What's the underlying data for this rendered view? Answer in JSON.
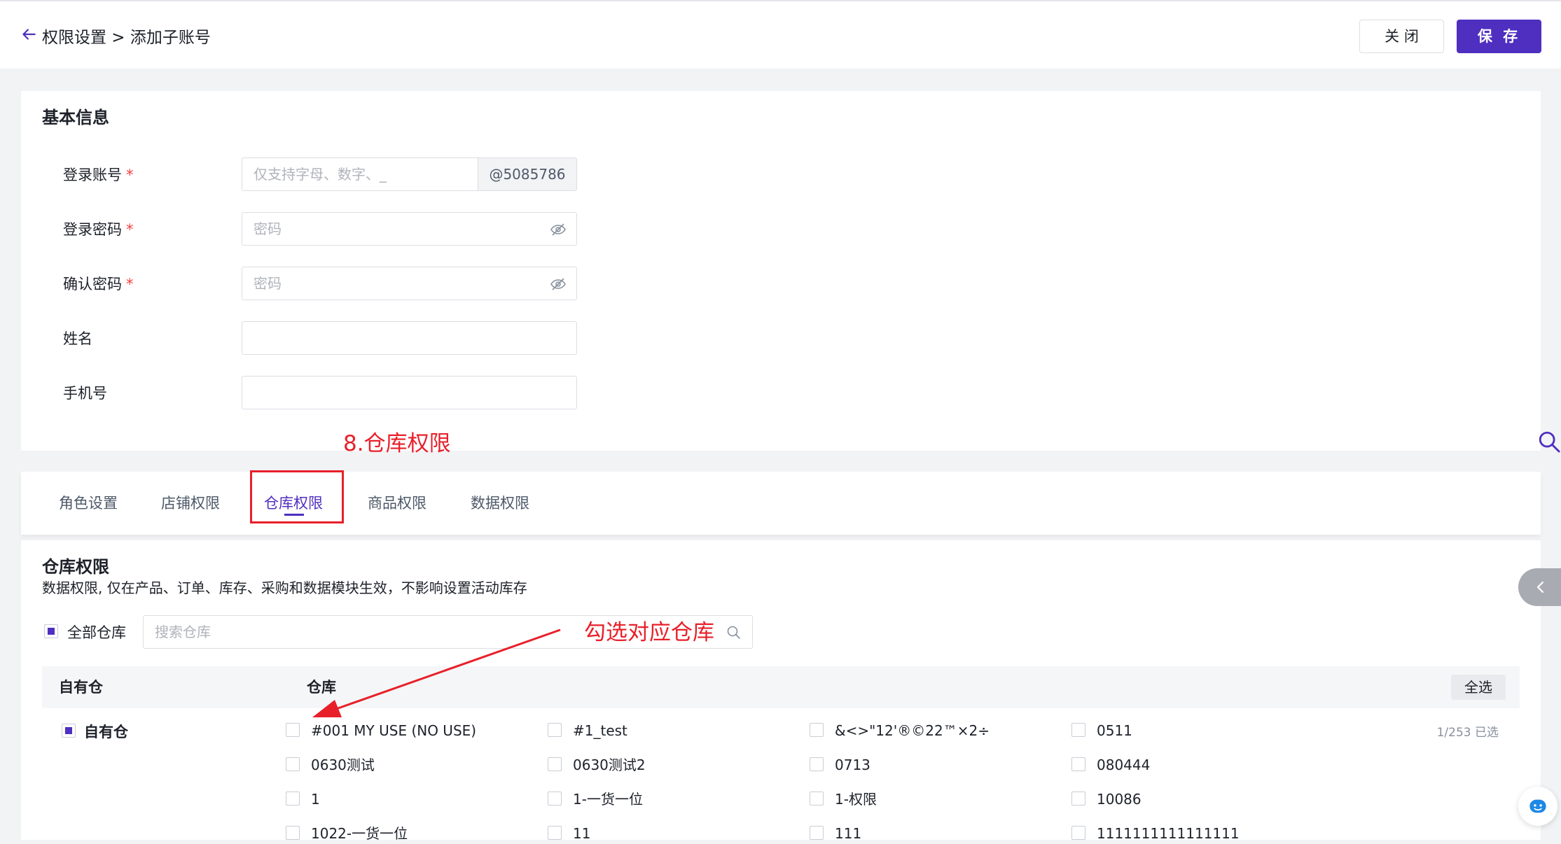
{
  "header": {
    "breadcrumb": "权限设置 > 添加子账号",
    "close_label": "关 闭",
    "save_label": "保 存"
  },
  "basic_info": {
    "title": "基本信息",
    "fields": {
      "account": {
        "label": "登录账号",
        "required": "*",
        "placeholder": "仅支持字母、数字、_",
        "suffix": "@5085786"
      },
      "password": {
        "label": "登录密码",
        "required": "*",
        "placeholder": "密码"
      },
      "confirm": {
        "label": "确认密码",
        "required": "*",
        "placeholder": "密码"
      },
      "name": {
        "label": "姓名",
        "value": ""
      },
      "phone": {
        "label": "手机号",
        "value": ""
      }
    }
  },
  "annotations": {
    "step_label": "8.仓库权限",
    "hint": "勾选对应仓库",
    "color": "#e8202a"
  },
  "tabs": [
    {
      "label": "角色设置"
    },
    {
      "label": "店铺权限"
    },
    {
      "label": "仓库权限",
      "active": true
    },
    {
      "label": "商品权限"
    },
    {
      "label": "数据权限"
    }
  ],
  "warehouse": {
    "title": "仓库权限",
    "description": "数据权限, 仅在产品、订单、库存、采购和数据模块生效，不影响设置活动库存",
    "all_label": "全部仓库",
    "search_placeholder": "搜索仓库",
    "col_own": "自有仓",
    "col_wh": "仓库",
    "select_all": "全选",
    "group": "自有仓",
    "count": "1/253 已选",
    "items": [
      "#001 MY USE (NO USE)",
      "#1_test",
      "&<>\"12'®©22™×2÷",
      "0511",
      "0630测试",
      "0630测试2",
      "0713",
      "080444",
      "1",
      "1-一货一位",
      "1-权限",
      "10086",
      "1022-一货一位",
      "11",
      "111",
      "1111111111111111"
    ]
  },
  "theme": {
    "accent": "#4e2fc0",
    "required": "#f53f3f"
  },
  "icons": [
    "back-arrow-icon",
    "eye-off-icon",
    "search-icon",
    "chevron-left-icon",
    "assistant-face-icon"
  ]
}
